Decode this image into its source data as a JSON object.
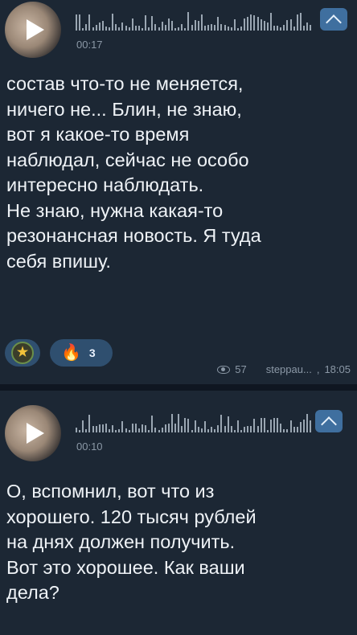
{
  "messages": [
    {
      "voice": {
        "duration": "00:17"
      },
      "text": "состав что-то не меняется,\nничего не... Блин, не знаю,\nвот я какое-то время\nнаблюдал, сейчас не особо\nинтересно наблюдать.\nНе знаю, нужна какая-то\nрезонансная новость. Я туда\nсебя впишу.",
      "reactions": [
        {
          "emoji_icon": "star-reaction-icon",
          "count": ""
        },
        {
          "emoji_icon": "fire-icon",
          "count": "3"
        }
      ],
      "views": "57",
      "author": "steppau...",
      "time": "18:05"
    },
    {
      "voice": {
        "duration": "00:10"
      },
      "text": "О, вспомнил, вот что из\nхорошего. 120 тысяч рублей\nна днях должен получить.\nВот это хорошее. Как ваши\nдела?"
    }
  ],
  "colors": {
    "accent": "#3f6f9f",
    "bubble": "#1c2734",
    "background": "#0f1621"
  }
}
